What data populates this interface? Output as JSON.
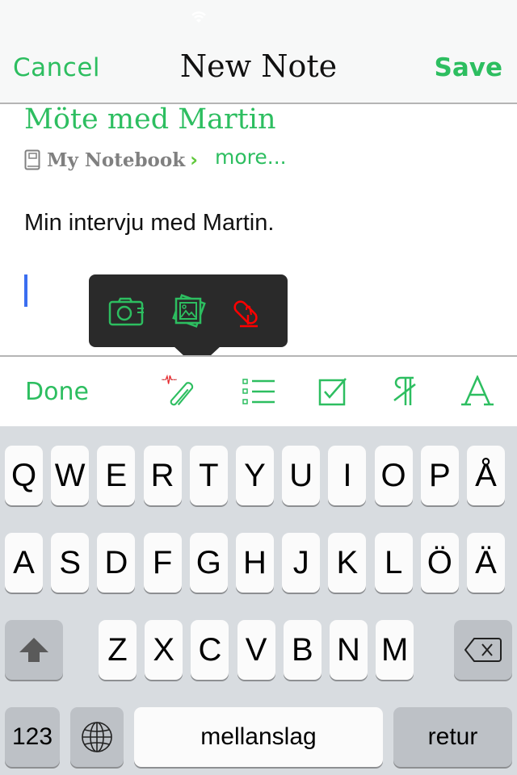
{
  "status_bar": {
    "wifi_icon": "wifi-icon"
  },
  "nav": {
    "cancel_label": "Cancel",
    "title": "New Note",
    "save_label": "Save"
  },
  "note": {
    "title": "Möte med Martin",
    "notebook": "My Notebook",
    "notebook_chevron": "›",
    "more_label": "more...",
    "body": "Min intervju med Martin."
  },
  "attachment_popover": {
    "items": [
      {
        "name": "camera",
        "icon": "camera-icon",
        "color": "#2dbe60"
      },
      {
        "name": "photos",
        "icon": "photo-library-icon",
        "color": "#2dbe60"
      },
      {
        "name": "audio",
        "icon": "microphone-icon",
        "color": "#ff0000"
      }
    ]
  },
  "toolbar": {
    "done_label": "Done",
    "icons": [
      "attachment-icon",
      "bulleted-list-icon",
      "checkbox-icon",
      "paragraph-format-icon",
      "text-format-icon"
    ],
    "accent": "#2dbe60",
    "recording_indicator_color": "#e8262b"
  },
  "keyboard": {
    "row1": [
      "Q",
      "W",
      "E",
      "R",
      "T",
      "Y",
      "U",
      "I",
      "O",
      "P",
      "Å"
    ],
    "row2": [
      "A",
      "S",
      "D",
      "F",
      "G",
      "H",
      "J",
      "K",
      "L",
      "Ö",
      "Ä"
    ],
    "row3": [
      "Z",
      "X",
      "C",
      "V",
      "B",
      "N",
      "M"
    ],
    "numbers_label": "123",
    "space_label": "mellanslag",
    "return_label": "retur"
  },
  "colors": {
    "accent": "#2dbe60",
    "caret": "#3b6ef0",
    "popover_bg": "#2a2a2a"
  }
}
